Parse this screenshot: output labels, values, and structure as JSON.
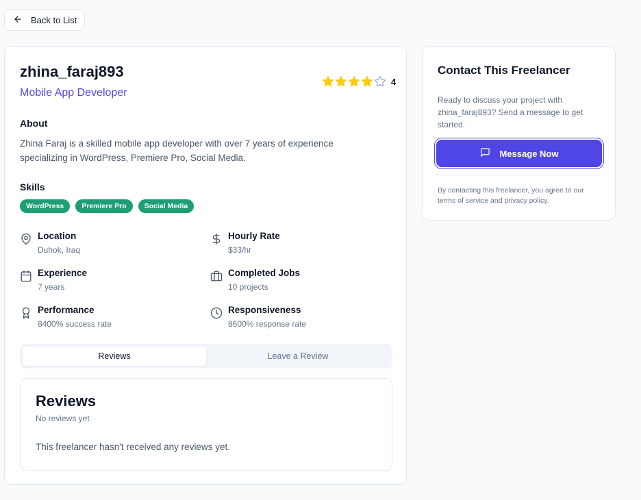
{
  "nav": {
    "back_label": "Back to List"
  },
  "profile": {
    "username": "zhina_faraj893",
    "role": "Mobile App Developer",
    "rating": 4,
    "rating_max": 5,
    "rating_label": "4"
  },
  "about": {
    "title": "About",
    "text": "Zhina Faraj is a skilled mobile app developer with over 7 years of experience specializing in WordPress, Premiere Pro, Social Media."
  },
  "skills": {
    "title": "Skills",
    "items": [
      "WordPress",
      "Premiere Pro",
      "Social Media"
    ]
  },
  "details": {
    "location": {
      "label": "Location",
      "value": "Duhok, Iraq"
    },
    "hourly_rate": {
      "label": "Hourly Rate",
      "value": "$33/hr"
    },
    "experience": {
      "label": "Experience",
      "value": "7 years"
    },
    "completed_jobs": {
      "label": "Completed Jobs",
      "value": "10 projects"
    },
    "performance": {
      "label": "Performance",
      "value": "8400% success rate"
    },
    "responsiveness": {
      "label": "Responsiveness",
      "value": "8600% response rate"
    }
  },
  "tabs": [
    {
      "label": "Reviews",
      "active": true
    },
    {
      "label": "Leave a Review",
      "active": false
    }
  ],
  "reviews": {
    "title": "Reviews",
    "subtitle": "No reviews yet",
    "empty_text": "This freelancer hasn't received any reviews yet."
  },
  "contact": {
    "title": "Contact This Freelancer",
    "text": "Ready to discuss your project with zhina_faraj893? Send a message to get started.",
    "button_label": "Message Now",
    "terms": "By contacting this freelancer, you agree to our terms of service and privacy policy."
  },
  "colors": {
    "accent": "#4f46e5",
    "skill_badge": "#1e9e75",
    "star": "#facc15"
  }
}
